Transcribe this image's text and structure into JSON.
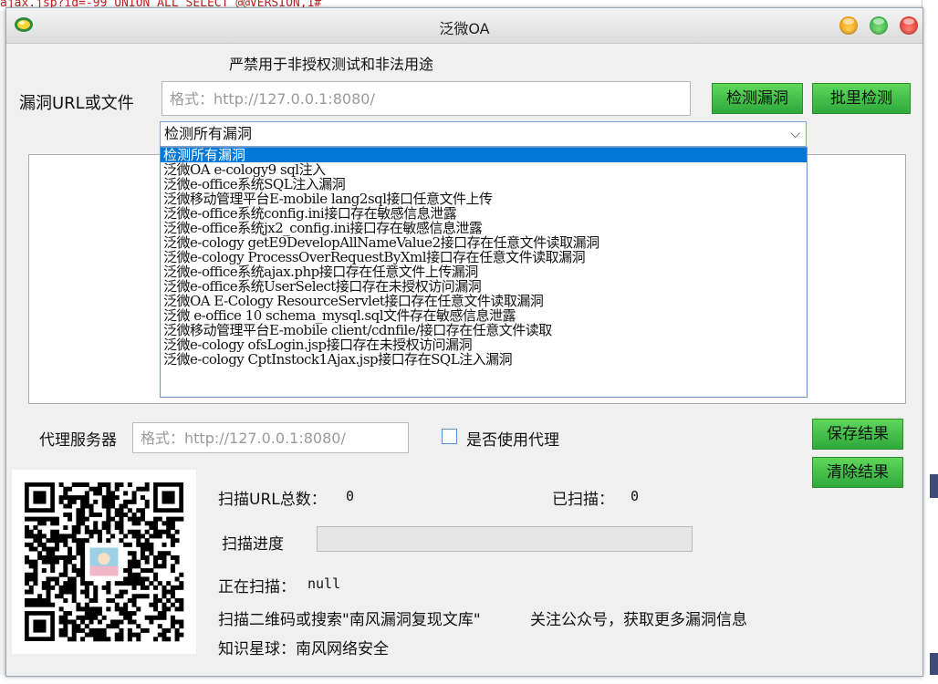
{
  "background": {
    "top_text": "ajax.jsp?id=-99 UNION ALL SELECT @@VERSION,1#"
  },
  "window": {
    "title": "泛微OA"
  },
  "warning": "严禁用于非授权测试和非法用途",
  "url": {
    "label": "漏洞URL或文件",
    "placeholder": "格式：http://127.0.0.1:8080/",
    "value": ""
  },
  "buttons": {
    "check": "检测漏洞",
    "batch": "批里检测",
    "save": "保存结果",
    "clear": "清除结果"
  },
  "vuln_select": {
    "selected": "检测所有漏洞",
    "options": [
      "检测所有漏洞",
      "泛微OA e-cology9 sql注入",
      "泛微e-office系统SQL注入漏洞",
      "泛微移动管理平台E-mobile lang2sql接口任意文件上传",
      "泛微e-office系统config.ini接口存在敏感信息泄露",
      "泛微e-office系统jx2_config.ini接口存在敏感信息泄露",
      "泛微e-cology getE9DevelopAllNameValue2接口存在任意文件读取漏洞",
      "泛微e-cology ProcessOverRequestByXml接口存在任意文件读取漏洞",
      "泛微e-office系统ajax.php接口存在任意文件上传漏洞",
      "泛微e-office系统UserSelect接口存在未授权访问漏洞",
      "泛微OA E-Cology ResourceServlet接口存在任意文件读取漏洞",
      "泛微 e-office 10 schema_mysql.sql文件存在敏感信息泄露",
      "泛微移动管理平台E-mobile client/cdnfile/接口存在任意文件读取",
      "泛微e-cology ofsLogin.jsp接口存在未授权访问漏洞",
      "泛微e-cology CptInstock1Ajax.jsp接口存在SQL注入漏洞"
    ]
  },
  "proxy": {
    "label": "代理服务器",
    "placeholder": "格式：http://127.0.0.1:8080/",
    "use_label": "是否使用代理",
    "use_checked": false
  },
  "stats": {
    "total_label": "扫描URL总数：",
    "total_value": "0",
    "scanned_label": "已扫描：",
    "scanned_value": "0",
    "progress_label": "扫描进度",
    "progress_fraction": 0,
    "current_label": "正在扫描：",
    "current_value": "null"
  },
  "footer": {
    "qr_text": "扫描二维码或搜索\"南风漏洞复现文库\"",
    "follow_text": "关注公众号，获取更多漏洞信息",
    "planet_text": "知识星球：南风网络安全"
  },
  "colors": {
    "green_button": "#3cc84a",
    "selection": "#0078d7",
    "close": "#e2342a",
    "minimize": "#f5b228",
    "maximize": "#3dbe4c"
  }
}
